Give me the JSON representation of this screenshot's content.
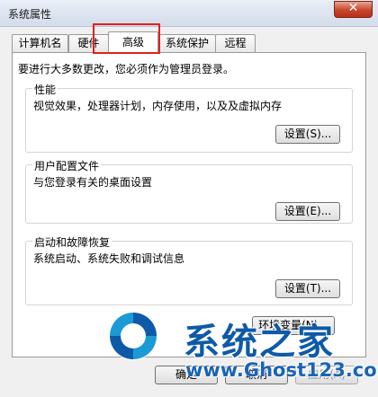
{
  "window": {
    "title": "系统属性",
    "close_glyph": "✕"
  },
  "tabs": [
    {
      "label": "计算机名"
    },
    {
      "label": "硬件"
    },
    {
      "label": "高级"
    },
    {
      "label": "系统保护"
    },
    {
      "label": "远程"
    }
  ],
  "active_tab": "高级",
  "notice": "要进行大多数更改，您必须作为管理员登录。",
  "groups": {
    "performance": {
      "title": "性能",
      "desc": "视觉效果，处理器计划，内存使用，以及及虚拟内存",
      "button": "设置(S)..."
    },
    "user_profiles": {
      "title": "用户配置文件",
      "desc": "与您登录有关的桌面设置",
      "button": "设置(E)..."
    },
    "startup_recovery": {
      "title": "启动和故障恢复",
      "desc": "系统启动、系统失败和调试信息",
      "button": "设置(T)..."
    }
  },
  "env_button": "环境变量(N)...",
  "footer": {
    "ok": "确定",
    "cancel": "取消",
    "apply": "应用(A)"
  },
  "watermark": {
    "text_cn": "系统之家",
    "url": "www.Ghost123.com",
    "icon": "ghost-logo-icon"
  },
  "colors": {
    "highlight": "#e02020",
    "watermark": "#0e5aa8"
  }
}
